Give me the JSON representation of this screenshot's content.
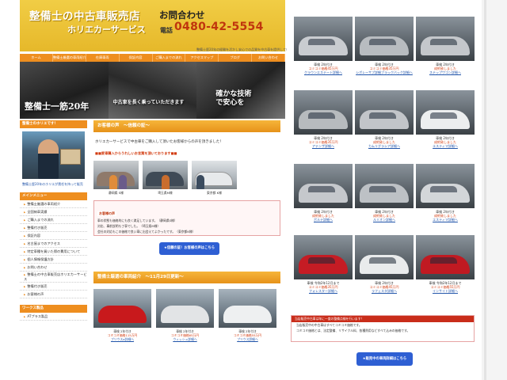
{
  "header": {
    "shop_name": "整備士の中古車販売店",
    "shop_sub": "ホリエカーサービス",
    "contact_title": "お問合わせ",
    "tel_label": "電話",
    "tel_number": "0480-42-5554",
    "tagline": "整備士歴20年の経験を活かし安心での品質を中古車を提供していま"
  },
  "nav": [
    "ホーム",
    "整備士厳選の車両紹介",
    "在庫車両",
    "保証内容",
    "ご購入までの流れ",
    "アクセスマップ",
    "ブログ",
    "お問い合わせ"
  ],
  "hero": {
    "panel1": "整備士一筋20年",
    "panel2": "中古車を長く乗っていただきます",
    "panel3_line1": "確かな技術",
    "panel3_line2": "で安心を"
  },
  "sidebar": {
    "profile_head": "整備士のホリエです！",
    "profile_caption": "整備士歴20年のホリエが責任を持って販売",
    "menu_head": "メインメニュー",
    "menu": [
      "整備士厳選の車両紹介",
      "全国納車実績",
      "ご購入までの流れ",
      "整備付き販売",
      "保証内容",
      "名古屋までのアクセス",
      "特定車種を買いた際の費用について",
      "個人情報保護方針",
      "お問い合わせ",
      "整備士の中古車販売店ホリエカーサービス",
      "整備付き販売",
      "お客様の声"
    ],
    "works_head": "ワークス製品",
    "works_item": "ATプラス製品"
  },
  "main": {
    "voices_head": "お客様の声　～信頼の証～",
    "intro": "ホリエカーサービスで中古車をご購入して頂いたお客様からの声を頂きました！",
    "notice": "■■愛車購入からうれしいお言葉を頂いております■■",
    "photos": [
      {
        "caption": "静岡県 S様"
      },
      {
        "caption": "埼玉県M様"
      },
      {
        "caption": "東京都 K様"
      }
    ],
    "voice_title": "お客様の声",
    "voice_lines": [
      "車の状態も価格的にも良く満足しています。（静岡県S様）",
      "対応、事前説明も丁寧でした。（埼玉県M様）",
      "会社の対応もこの価格で良い車に出会えてよかったです。（東京都K様）"
    ],
    "voices_button": "★信頼の証！お客様の声はこちら",
    "stock_head": "整備士厳選の車両紹介　～11月29日更新～",
    "cars": [
      {
        "year": "車検 2年付き",
        "price": "コミコミ価格115万円",
        "detail": "プリウスα詳細へ"
      },
      {
        "year": "車検 2年付き",
        "price": "コミコミ価格65万円",
        "detail": "ウィッシュ詳細へ"
      },
      {
        "year": "車検 2年付き",
        "price": "コミコミ価格55万円",
        "detail": "プリウス詳細へ"
      }
    ]
  },
  "right": {
    "cars": [
      {
        "year": "車検 2年付き",
        "price": "コミコミ価格45万円",
        "detail": "クラウンエステート詳細へ"
      },
      {
        "year": "車検 2年付き",
        "price": "コミコミ価格35万円",
        "detail": "シボレーサブ詳細ブラックバック詳細へ"
      },
      {
        "year": "車検 2年付き",
        "status": "成約致しました",
        "detail": "ステップワゴン詳細へ"
      },
      {
        "year": "車検 2年付き",
        "price": "コミコミ価格35万円",
        "detail": "アテンザ詳細へ"
      },
      {
        "year": "車検 2年付き",
        "status": "成約致しました",
        "detail": "カムリグラシア詳細へ"
      },
      {
        "year": "車検 2年付き",
        "status": "成約致しました",
        "detail": "エスティマ詳細へ"
      },
      {
        "year": "車検 2年付き",
        "status": "成約致しました",
        "detail": "ポルテ詳細へ"
      },
      {
        "year": "車検 2年付き",
        "status": "成約致しました",
        "detail": "ルミオン詳細へ"
      },
      {
        "year": "車検 2年付き",
        "status": "成約致しました",
        "detail": "エスティマ詳細へ"
      },
      {
        "year": "車検 令和2年12月まで",
        "price": "コミコミ価格35万円",
        "detail": "フォレスター詳細へ"
      },
      {
        "year": "車検 2年付き",
        "price": "コミコミ価格45万円",
        "detail": "ラフェスタ詳細へ"
      },
      {
        "year": "車検 令和2年12月まで",
        "price": "コミコミ価格55万円",
        "detail": "インサイト詳細へ"
      }
    ],
    "feature_head": "当店販売中古車は年に一度の整備点検を行います！",
    "feature_lines": [
      "当店販売中の中古車はすべてコミコミ価格です。",
      "コミコミ価格とは、法定整備、リサイクル料、各種費用などすべて込みの価格です。"
    ],
    "car_list_button": "★販売中の車両詳細はこちら"
  },
  "colors": {
    "header_gold": "#e9c03a",
    "nav_orange": "#ee8e1f",
    "price_red": "#d23a0e",
    "link_blue": "#2255aa",
    "button_blue": "#2e5fd3"
  }
}
